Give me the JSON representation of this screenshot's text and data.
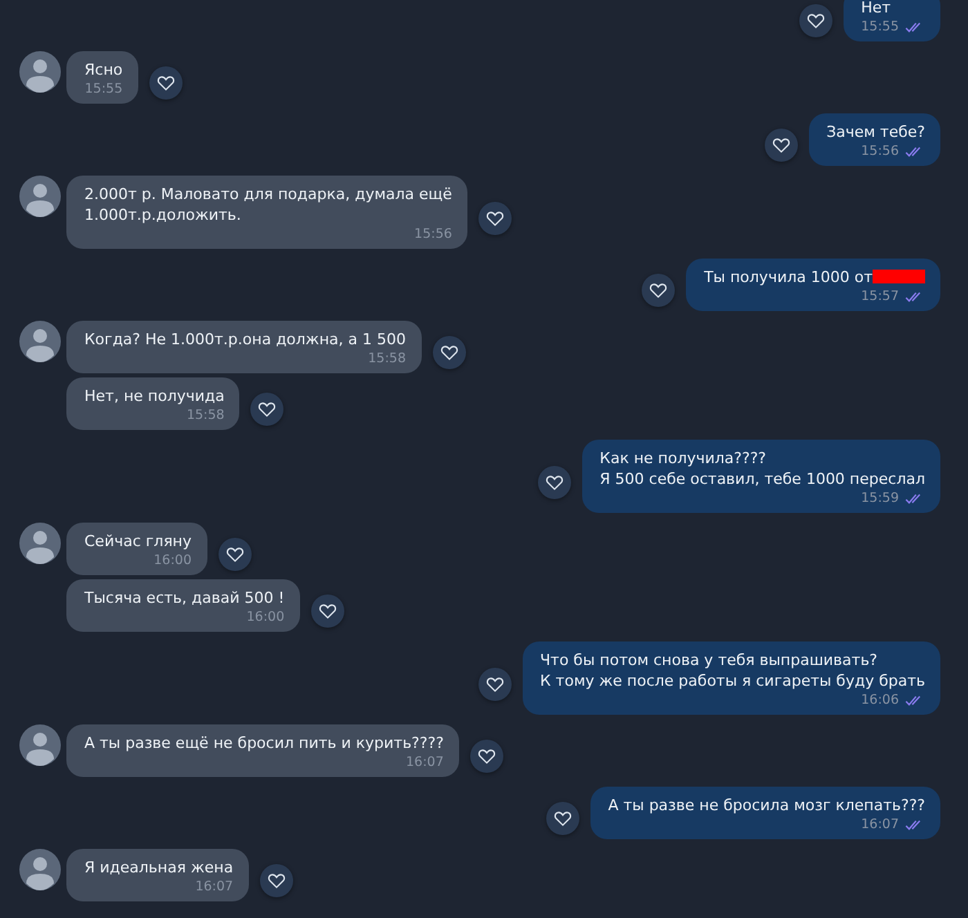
{
  "messages": [
    {
      "kind": "outgoing",
      "text": "Нет",
      "time": "15:55",
      "read": true
    },
    {
      "kind": "incoming",
      "avatar": true,
      "text": "Ясно",
      "time": "15:55"
    },
    {
      "kind": "outgoing",
      "text": "Зачем тебе?",
      "time": "15:56",
      "read": true
    },
    {
      "kind": "incoming",
      "avatar": true,
      "text": "2.000т р. Маловато для подарка, думала ещё\n1.000т.р.доложить.",
      "time": "15:56"
    },
    {
      "kind": "outgoing",
      "text": "Ты получила 1000 от",
      "redacted": true,
      "time": "15:57",
      "read": true
    },
    {
      "kind": "incoming",
      "avatar": true,
      "text": "Когда? Не 1.000т.р.она должна, а 1 500",
      "time": "15:58"
    },
    {
      "kind": "incoming",
      "avatar": false,
      "text": "Нет, не получида",
      "time": "15:58"
    },
    {
      "kind": "outgoing",
      "text": "Как не получила????\nЯ 500 себе оставил, тебе 1000 переслал",
      "time": "15:59",
      "read": true
    },
    {
      "kind": "incoming",
      "avatar": true,
      "text": "Сейчас гляну",
      "time": "16:00"
    },
    {
      "kind": "incoming",
      "avatar": false,
      "text": "Тысяча есть, давай 500 !",
      "time": "16:00"
    },
    {
      "kind": "outgoing",
      "text": "Что бы потом снова у тебя выпрашивать?\nК тому же после работы я сигареты буду брать",
      "time": "16:06",
      "read": true
    },
    {
      "kind": "incoming",
      "avatar": true,
      "text": "А ты разве ещё не бросил пить и курить????",
      "time": "16:07"
    },
    {
      "kind": "outgoing",
      "text": "А ты разве не бросила мозг клепать???",
      "time": "16:07",
      "read": true
    },
    {
      "kind": "incoming",
      "avatar": true,
      "text": "Я идеальная жена",
      "time": "16:07"
    }
  ]
}
